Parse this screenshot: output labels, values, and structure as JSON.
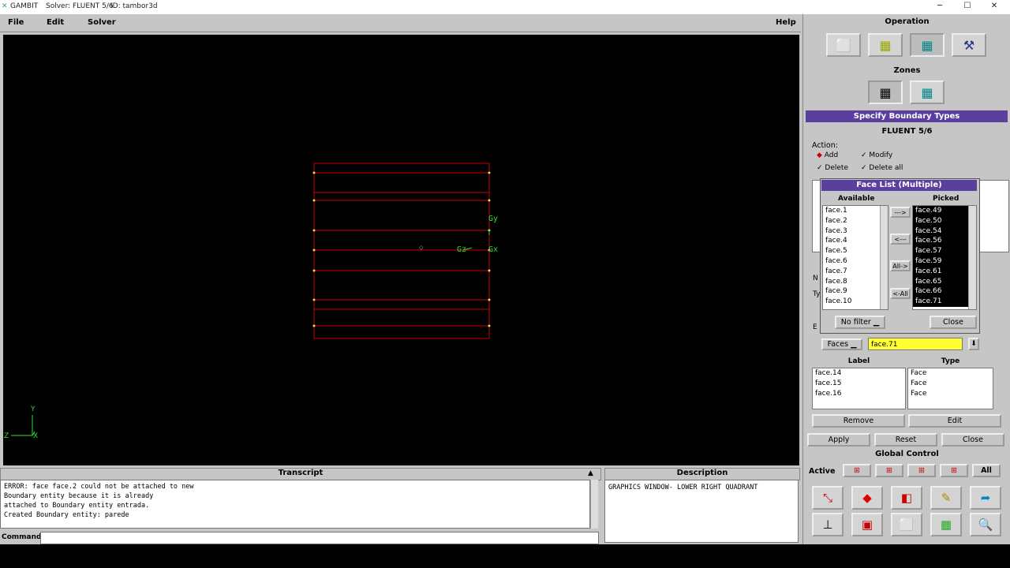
{
  "titlebar": {
    "app": "GAMBIT",
    "solver": "Solver: FLUENT 5/6",
    "id": "ID: tambor3d",
    "min": "─",
    "max": "☐",
    "close": "✕"
  },
  "menu": {
    "file": "File",
    "edit": "Edit",
    "solver": "Solver",
    "help": "Help"
  },
  "graphics": {
    "labels": {
      "gy": "Gy",
      "gz": "Gz",
      "gx": "Gx",
      "y": "Y",
      "z": "Z",
      "x": "X"
    },
    "mesh_color": "#cc0000",
    "vertex_color": "#e0e060",
    "axis_color": "#33dd33"
  },
  "transcript": {
    "title": "Transcript",
    "lines": [
      "ERROR: face face.2 could not be attached to new",
      "Boundary entity because it is already",
      "attached to Boundary entity entrada.",
      "Created Boundary entity: parede"
    ]
  },
  "description": {
    "title": "Description",
    "text": "GRAPHICS WINDOW- LOWER RIGHT QUADRANT"
  },
  "command": {
    "label": "Command:",
    "value": ""
  },
  "panel": {
    "operation": "Operation",
    "zones": "Zones",
    "form_title": "Specify Boundary Types",
    "solver": "FLUENT 5/6",
    "action": "Action:",
    "add": "Add",
    "modify": "Modify",
    "delete": "Delete",
    "delete_all": "Delete all",
    "face_list_title": "Face List (Multiple)",
    "available_hdr": "Available",
    "picked_hdr": "Picked",
    "available": [
      "face.1",
      "face.2",
      "face.3",
      "face.4",
      "face.5",
      "face.6",
      "face.7",
      "face.8",
      "face.9",
      "face.10"
    ],
    "picked": [
      "face.49",
      "face.50",
      "face.54",
      "face.56",
      "face.57",
      "face.59",
      "face.61",
      "face.65",
      "face.66",
      "face.71"
    ],
    "move_right": "--->",
    "move_left": "<---",
    "all_right": "All->",
    "all_left": "<-All",
    "filter": "No filter",
    "close": "Close",
    "entity_type": "Faces",
    "entity_value": "face.71",
    "label_hdr": "Label",
    "type_hdr": "Type",
    "rows": [
      {
        "label": "face.14",
        "type": "Face"
      },
      {
        "label": "face.15",
        "type": "Face"
      },
      {
        "label": "face.16",
        "type": "Face"
      }
    ],
    "remove": "Remove",
    "edit": "Edit",
    "apply": "Apply",
    "reset": "Reset",
    "close2": "Close",
    "global_control": "Global Control",
    "active": "Active",
    "all": "All",
    "partial_n": "N",
    "partial_t": "Ty",
    "partial_e": "E"
  }
}
